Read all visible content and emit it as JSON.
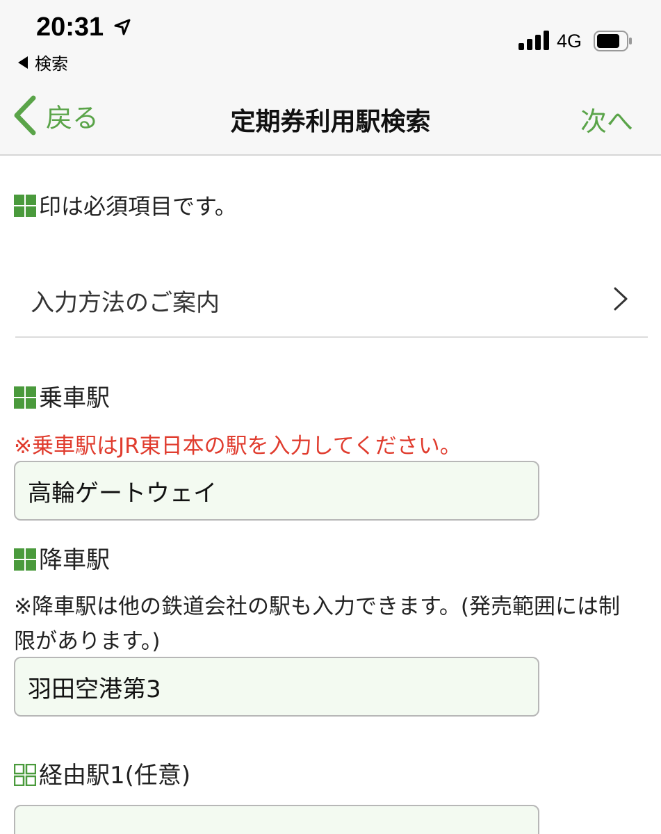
{
  "status_bar": {
    "time": "20:31",
    "back_app": "検索",
    "network": "4G"
  },
  "nav": {
    "back_label": "戻る",
    "title": "定期券利用駅検索",
    "next_label": "次へ"
  },
  "required_note": "印は必須項目です。",
  "guide_link": "入力方法のご案内",
  "boarding": {
    "label": "乗車駅",
    "note": "※乗車駅はJR東日本の駅を入力してください。",
    "value": "高輪ゲートウェイ"
  },
  "alighting": {
    "label": "降車駅",
    "note": "※降車駅は他の鉄道会社の駅も入力できます。(発売範囲には制限があります。)",
    "value": "羽田空港第3"
  },
  "via1": {
    "label": "経由駅1(任意)",
    "value": ""
  },
  "colors": {
    "accent_green": "#5aa449",
    "required_icon": "#4a9a3c",
    "warning_red": "#e03c2e",
    "field_bg": "#f3faf1"
  }
}
